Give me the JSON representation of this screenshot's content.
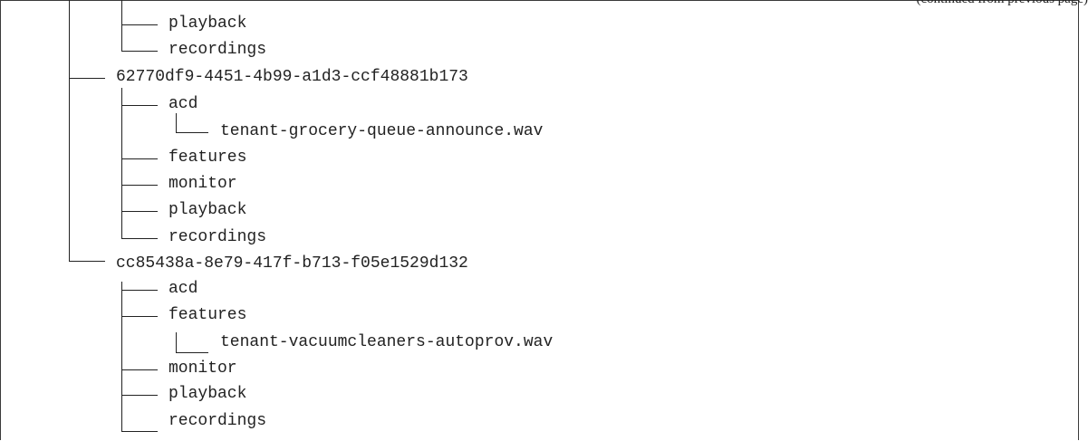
{
  "caption": "(continued from previous page)",
  "tree": {
    "rows": [
      {
        "name": "playback"
      },
      {
        "name": "recordings"
      },
      {
        "name": "62770df9-4451-4b99-a1d3-ccf48881b173"
      },
      {
        "name": "acd"
      },
      {
        "name": "tenant-grocery-queue-announce.wav"
      },
      {
        "name": "features"
      },
      {
        "name": "monitor"
      },
      {
        "name": "playback"
      },
      {
        "name": "recordings"
      },
      {
        "name": "cc85438a-8e79-417f-b713-f05e1529d132"
      },
      {
        "name": "acd"
      },
      {
        "name": "features"
      },
      {
        "name": "tenant-vacuumcleaners-autoprov.wav"
      },
      {
        "name": "monitor"
      },
      {
        "name": "playback"
      },
      {
        "name": "recordings"
      }
    ]
  }
}
